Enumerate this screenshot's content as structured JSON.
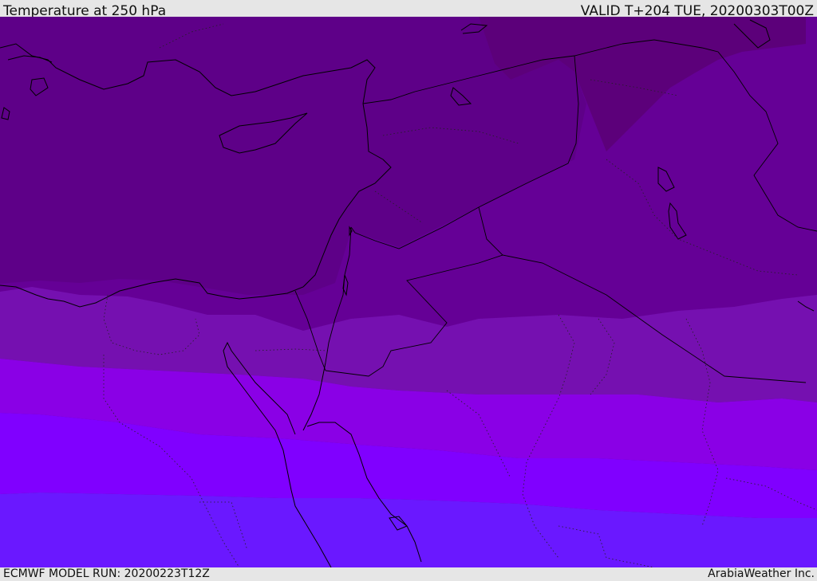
{
  "header": {
    "title": "Temperature at 250 hPa",
    "valid": "VALID T+204 TUE, 20200303T00Z"
  },
  "footer": {
    "model_run": "ECMWF MODEL RUN: 20200223T12Z",
    "credit": "ArabiaWeather Inc."
  },
  "map": {
    "layers": [
      "temperature-bands",
      "coastlines",
      "country-borders",
      "region-borders"
    ],
    "band_colors": [
      "#5c007a",
      "#650096",
      "#7b10b8",
      "#8a00e6",
      "#8000ff",
      "#6a18ff"
    ]
  }
}
